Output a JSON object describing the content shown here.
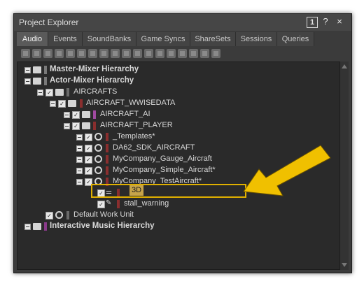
{
  "window": {
    "title": "Project Explorer",
    "title_buttons": [
      "1",
      "?",
      "×"
    ]
  },
  "tabs": [
    "Audio",
    "Events",
    "SoundBanks",
    "Game Syncs",
    "ShareSets",
    "Sessions",
    "Queries"
  ],
  "tree": {
    "items": [
      {
        "label": "Master-Mixer Hierarchy",
        "color": "#7a7a7a"
      },
      {
        "label": "Actor-Mixer Hierarchy",
        "color": "#7a7a7a"
      },
      {
        "label": "AIRCRAFTS",
        "color": "#6a6a6a"
      },
      {
        "label": "AIRCRAFT_WWISEDATA",
        "color": "#8a2e2e"
      },
      {
        "label": "AIRCRAFT_AI",
        "color": "#a04aa0"
      },
      {
        "label": "AIRCRAFT_PLAYER",
        "color": "#8a2e2e"
      },
      {
        "label": "_Templates*",
        "color": "#8a2e2e"
      },
      {
        "label": "DA62_SDK_AIRCRAFT",
        "color": "#8a2e2e"
      },
      {
        "label": "MyCompany_Gauge_Aircraft",
        "color": "#8a2e2e"
      },
      {
        "label": "MyCompany_Simple_Aircraft*",
        "color": "#8a2e2e"
      },
      {
        "label": "MyCompany_TestAircraft*",
        "color": "#8a2e2e"
      },
      {
        "label": "3D",
        "color": "#8a2e2e"
      },
      {
        "label": "stall_warning",
        "color": "#8a2e2e"
      },
      {
        "label": "Default Work Unit",
        "color": "#6a6a6a"
      },
      {
        "label": "Interactive Music Hierarchy",
        "color": "#8a3a8a"
      }
    ]
  },
  "highlight_color": "#e0b000"
}
